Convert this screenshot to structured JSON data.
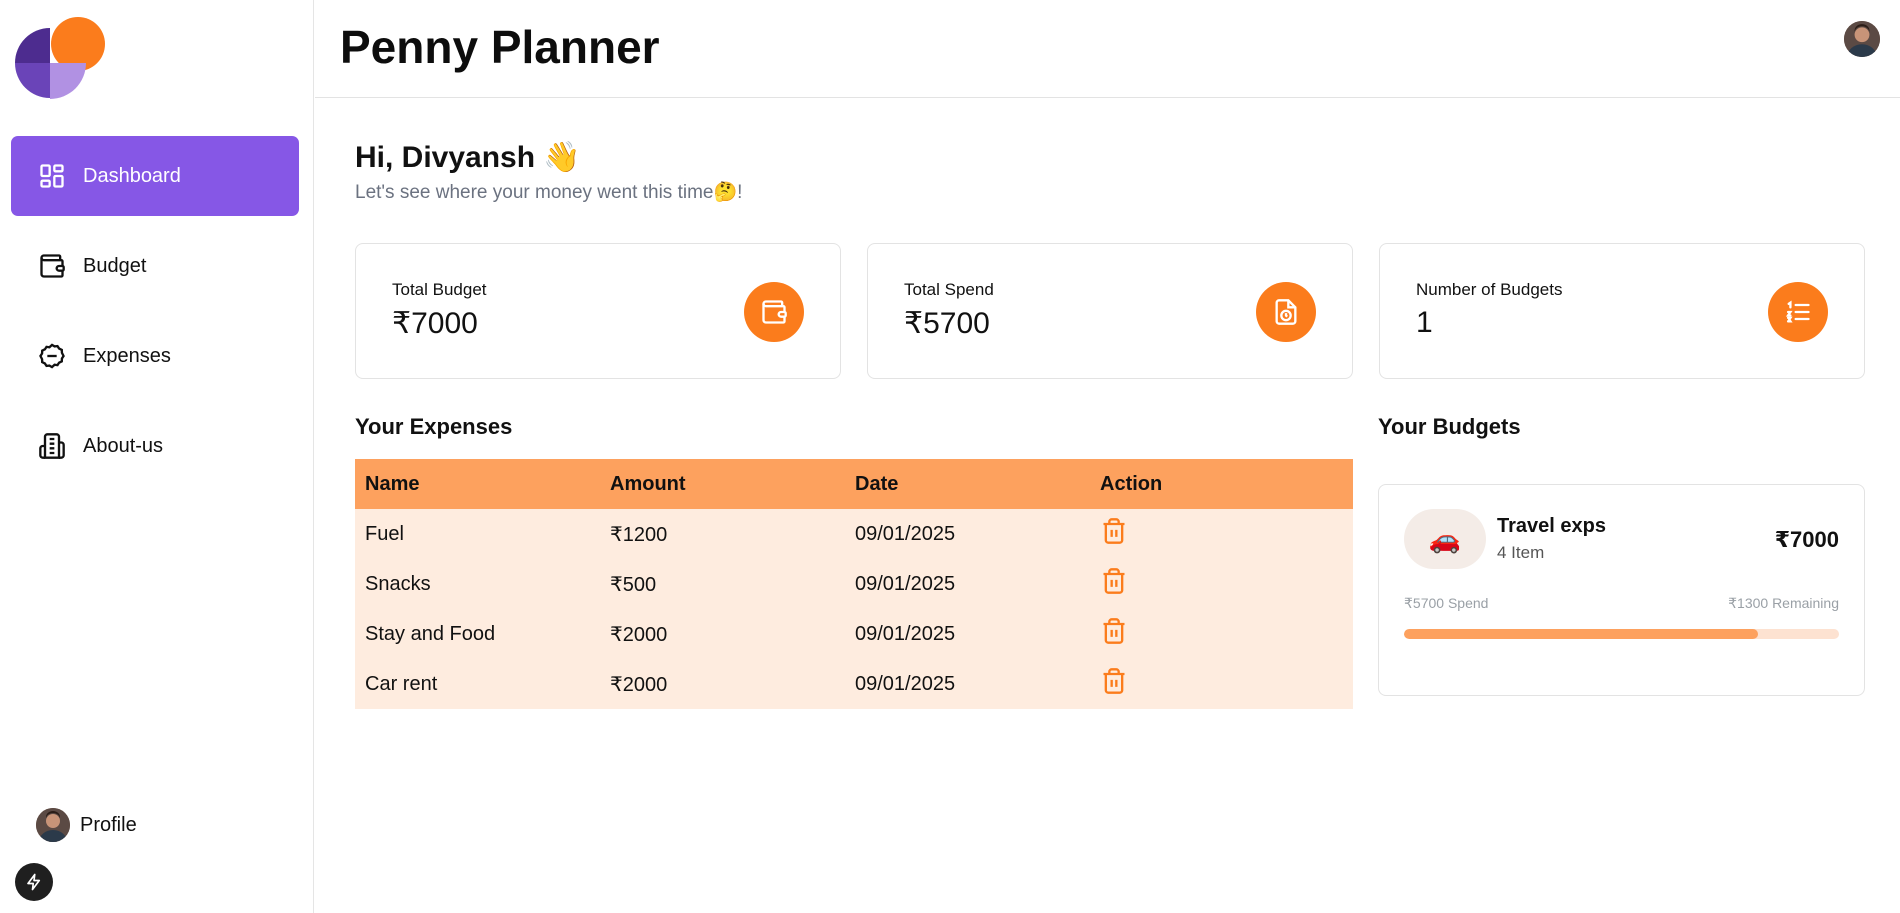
{
  "sidebar": {
    "items": [
      {
        "label": "Dashboard",
        "icon": "dashboard-icon",
        "active": true
      },
      {
        "label": "Budget",
        "icon": "wallet-icon",
        "active": false
      },
      {
        "label": "Expenses",
        "icon": "expense-icon",
        "active": false
      },
      {
        "label": "About-us",
        "icon": "building-icon",
        "active": false
      }
    ],
    "profile_label": "Profile"
  },
  "header": {
    "title": "Penny Planner"
  },
  "main": {
    "greeting": "Hi, Divyansh 👋",
    "subtitle": "Let's see where your money went this time🤔!",
    "cards": [
      {
        "label": "Total Budget",
        "value": "₹7000",
        "icon": "wallet-icon"
      },
      {
        "label": "Total Spend",
        "value": "₹5700",
        "icon": "receipt-icon"
      },
      {
        "label": "Number of Budgets",
        "value": "1",
        "icon": "list-icon"
      }
    ],
    "expenses_title": "Your Expenses",
    "budgets_title": "Your Budgets",
    "table": {
      "headers": [
        "Name",
        "Amount",
        "Date",
        "Action"
      ],
      "rows": [
        {
          "name": "Fuel",
          "amount": "₹1200",
          "date": "09/01/2025"
        },
        {
          "name": "Snacks",
          "amount": "₹500",
          "date": "09/01/2025"
        },
        {
          "name": "Stay and Food",
          "amount": "₹2000",
          "date": "09/01/2025"
        },
        {
          "name": "Car rent",
          "amount": "₹2000",
          "date": "09/01/2025"
        }
      ]
    },
    "budget": {
      "emoji": "🚗",
      "name": "Travel exps",
      "items": "4 Item",
      "amount": "₹7000",
      "spend": "₹5700 Spend",
      "remaining": "₹1300 Remaining",
      "progress_fraction": 0.814
    }
  },
  "colors": {
    "accent_purple": "#8657e6",
    "accent_orange": "#fb7c1c",
    "table_header": "#fda15e",
    "table_body": "#feecdf"
  }
}
